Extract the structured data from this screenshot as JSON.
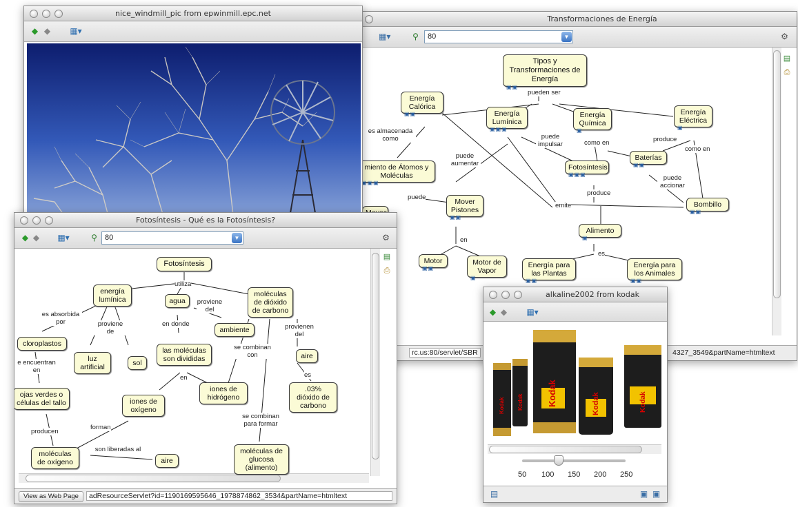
{
  "windows": {
    "energia": {
      "title": "Transformaciones de Energía",
      "zoom": "80",
      "status": "rc.us:80/servlet/SBR",
      "status_right": "4327_3549&partName=htmltext"
    },
    "windmill": {
      "title": "nice_windmill_pic from epwinmill.epc.net"
    },
    "foto": {
      "title": "Fotosíntesis - Qué es la Fotosíntesis?",
      "zoom": "80",
      "status_button": "View as Web Page",
      "status": "adResourceServlet?id=1190169595646_1978874862_3534&partName=htmltext"
    },
    "kodak": {
      "title": "alkaline2002 from kodak",
      "ticks": [
        "50",
        "100",
        "150",
        "200",
        "250"
      ],
      "brand": "Kodak"
    }
  },
  "energia_map": {
    "nodes": {
      "tipos": "Tipos y Transformaciones de Energía",
      "calorica": "Energía Calórica",
      "luminica": "Energía Lumínica",
      "quimica": "Energía Química",
      "electrica": "Energía Eléctrica",
      "atomos": "miento de Átomos y Moléculas",
      "baterias": "Baterías",
      "fotosintesis": "Fotosíntesis",
      "mover": "Mover Pistones",
      "bombillo": "Bombillo",
      "alimento": "Alimento",
      "movec": "Movec",
      "motor": "Motor",
      "motor_vapor": "Motor de Vapor",
      "plantas": "Energía para las Plantas",
      "animales": "Energía para los Animales"
    },
    "links": {
      "pueden_ser": "pueden ser",
      "almacenada": "es almacenada como",
      "aumentar": "puede aumentar",
      "impulsar": "puede impulsar",
      "como_en1": "como en",
      "produce1": "produce",
      "como_en2": "como en",
      "accionar": "puede accionar",
      "produce2": "produce",
      "emite": "emite",
      "puede": "puede",
      "en": "en",
      "es": "es"
    }
  },
  "foto_map": {
    "nodes": {
      "fotosintesis": "Fotosíntesis",
      "energia_luminica": "energía lumínica",
      "agua": "agua",
      "moleculas_dioxido": "moléculas de dióxido de carbono",
      "ambiente": "ambiente",
      "cloroplastos": "cloroplastos",
      "luz": "luz artificial",
      "sol": "sol",
      "divididas": "las moléculas son divididas",
      "aire1": "aire",
      "hojas": "ojas verdes o células del tallo",
      "iones_oxigeno": "iones de oxígeno",
      "iones_hidrogeno": "iones de hidrógeno",
      "dioxido03": ".03% dióxido de carbono",
      "moleculas_oxigeno": "moléculas de oxígeno",
      "aire2": "aire",
      "glucosa": "moléculas de glucosa (alimento)"
    },
    "links": {
      "utiliza": "utiliza",
      "absorbida": "es absorbida por",
      "proviene_de": "proviene de",
      "proviene_del": "proviene del",
      "en_donde": "en donde",
      "se_combinan_con": "se combinan con",
      "provienen_del": "provienen del",
      "encuentran": "e encuentran en",
      "en": "en",
      "es": "es",
      "forman": "forman",
      "producen": "producen",
      "se_combinan_para": "se combinan para formar",
      "liberadas": "son liberadas al"
    }
  }
}
